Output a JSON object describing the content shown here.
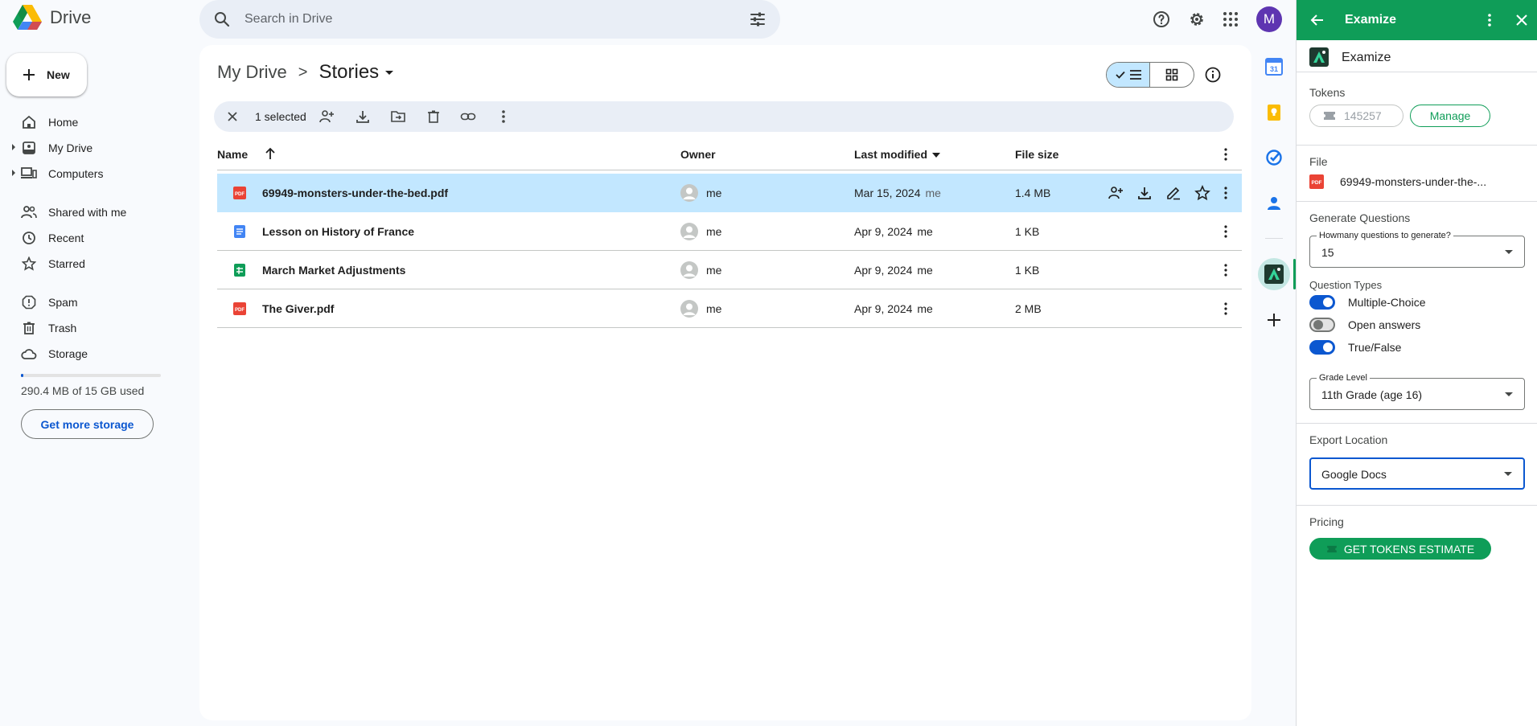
{
  "app": {
    "title": "Drive"
  },
  "search": {
    "placeholder": "Search in Drive"
  },
  "account": {
    "initial": "M"
  },
  "new_button": {
    "label": "New"
  },
  "nav": {
    "items": [
      {
        "label": "Home",
        "icon": "home-icon"
      },
      {
        "label": "My Drive",
        "icon": "drive-icon"
      },
      {
        "label": "Computers",
        "icon": "computer-icon"
      },
      {
        "label": "Shared with me",
        "icon": "people-icon"
      },
      {
        "label": "Recent",
        "icon": "clock-icon"
      },
      {
        "label": "Starred",
        "icon": "star-icon"
      },
      {
        "label": "Spam",
        "icon": "spam-icon"
      },
      {
        "label": "Trash",
        "icon": "trash-icon"
      },
      {
        "label": "Storage",
        "icon": "cloud-icon"
      }
    ]
  },
  "storage": {
    "used_text": "290.4 MB of 15 GB used",
    "used_fraction": 0.019,
    "button_label": "Get more storage"
  },
  "breadcrumb": {
    "root": "My Drive",
    "separator": ">",
    "current": "Stories"
  },
  "selection": {
    "count_text": "1 selected"
  },
  "table": {
    "headers": {
      "name": "Name",
      "owner": "Owner",
      "modified": "Last modified",
      "size": "File size"
    },
    "rows": [
      {
        "name": "69949-monsters-under-the-bed.pdf",
        "type": "pdf",
        "owner": "me",
        "modified": "Mar 15, 2024",
        "modified_by": "me",
        "size": "1.4 MB",
        "selected": true
      },
      {
        "name": "Lesson on History of France",
        "type": "doc",
        "owner": "me",
        "modified": "Apr 9, 2024",
        "modified_by": "me",
        "size": "1 KB",
        "selected": false
      },
      {
        "name": "March Market Adjustments",
        "type": "sheet",
        "owner": "me",
        "modified": "Apr 9, 2024",
        "modified_by": "me",
        "size": "1 KB",
        "selected": false
      },
      {
        "name": "The Giver.pdf",
        "type": "pdf",
        "owner": "me",
        "modified": "Apr 9, 2024",
        "modified_by": "me",
        "size": "2 MB",
        "selected": false
      }
    ]
  },
  "panel": {
    "title": "Examize",
    "brand": "Examize",
    "tokens": {
      "label": "Tokens",
      "value": "145257",
      "manage_label": "Manage"
    },
    "file": {
      "label": "File",
      "name": "69949-monsters-under-the-..."
    },
    "generate": {
      "label": "Generate Questions",
      "count_legend": "Howmany questions to generate?",
      "count_value": "15"
    },
    "question_types": {
      "label": "Question Types",
      "options": [
        {
          "label": "Multiple-Choice",
          "enabled": true
        },
        {
          "label": "Open answers",
          "enabled": false
        },
        {
          "label": "True/False",
          "enabled": true
        }
      ]
    },
    "grade": {
      "legend": "Grade Level",
      "value": "11th Grade (age 16)"
    },
    "export": {
      "label": "Export Location",
      "value": "Google Docs"
    },
    "pricing": {
      "label": "Pricing",
      "button_label": "GET TOKENS ESTIMATE"
    }
  },
  "colors": {
    "accent": "#0f9d58",
    "selection": "#c2e7ff",
    "primary": "#0b57d0"
  }
}
